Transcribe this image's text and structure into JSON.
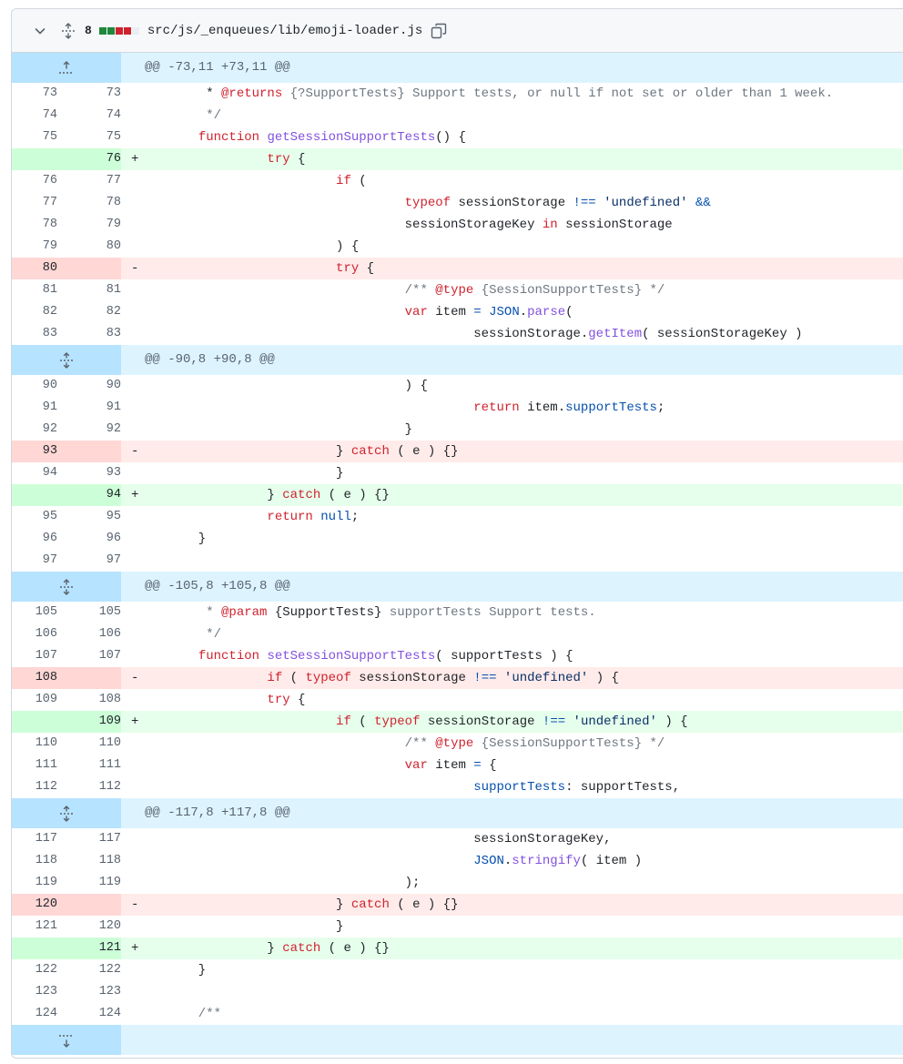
{
  "file": {
    "change_count": "8",
    "path": "src/js/_enqueues/lib/emoji-loader.js",
    "diffstat_colors": [
      "#1f883d",
      "#1f883d",
      "#cf222e",
      "#cf222e",
      "#eaeef2"
    ]
  },
  "hunks": [
    {
      "header": "@@ -73,11 +73,11 @@",
      "expand": "up",
      "lines": [
        {
          "type": "ctx",
          "old": "73",
          "new": "73",
          "tokens": [
            [
              "t",
              "        * "
            ],
            [
              "k",
              "@returns"
            ],
            [
              "c",
              " {?SupportTests} Support tests, or null if not set or older than 1 week."
            ]
          ]
        },
        {
          "type": "ctx",
          "old": "74",
          "new": "74",
          "tokens": [
            [
              "c",
              "        */"
            ]
          ]
        },
        {
          "type": "ctx",
          "old": "75",
          "new": "75",
          "tokens": [
            [
              "t",
              "       "
            ],
            [
              "k",
              "function"
            ],
            [
              "t",
              " "
            ],
            [
              "f",
              "getSessionSupportTests"
            ],
            [
              "t",
              "() {"
            ]
          ]
        },
        {
          "type": "add",
          "old": "",
          "new": "76",
          "sign": "+",
          "tokens": [
            [
              "t",
              "                "
            ],
            [
              "k",
              "try"
            ],
            [
              "t",
              " {"
            ]
          ]
        },
        {
          "type": "ctx",
          "old": "76",
          "new": "77",
          "tokens": [
            [
              "t",
              "                         "
            ],
            [
              "k",
              "if"
            ],
            [
              "t",
              " ("
            ]
          ]
        },
        {
          "type": "ctx",
          "old": "77",
          "new": "78",
          "tokens": [
            [
              "t",
              "                                  "
            ],
            [
              "k",
              "typeof"
            ],
            [
              "t",
              " sessionStorage "
            ],
            [
              "b",
              "!=="
            ],
            [
              "t",
              " "
            ],
            [
              "s",
              "'undefined'"
            ],
            [
              "t",
              " "
            ],
            [
              "b",
              "&&"
            ]
          ]
        },
        {
          "type": "ctx",
          "old": "78",
          "new": "79",
          "tokens": [
            [
              "t",
              "                                  sessionStorageKey "
            ],
            [
              "k",
              "in"
            ],
            [
              "t",
              " sessionStorage"
            ]
          ]
        },
        {
          "type": "ctx",
          "old": "79",
          "new": "80",
          "tokens": [
            [
              "t",
              "                         ) {"
            ]
          ]
        },
        {
          "type": "del",
          "old": "80",
          "new": "",
          "sign": "-",
          "tokens": [
            [
              "t",
              "                         "
            ],
            [
              "k",
              "try"
            ],
            [
              "t",
              " {"
            ]
          ]
        },
        {
          "type": "ctx",
          "old": "81",
          "new": "81",
          "tokens": [
            [
              "c",
              "                                  /** "
            ],
            [
              "k",
              "@type"
            ],
            [
              "c",
              " {SessionSupportTests} */"
            ]
          ]
        },
        {
          "type": "ctx",
          "old": "82",
          "new": "82",
          "tokens": [
            [
              "t",
              "                                  "
            ],
            [
              "k",
              "var"
            ],
            [
              "t",
              " item "
            ],
            [
              "b",
              "="
            ],
            [
              "t",
              " "
            ],
            [
              "b",
              "JSON"
            ],
            [
              "t",
              "."
            ],
            [
              "f",
              "parse"
            ],
            [
              "t",
              "("
            ]
          ]
        },
        {
          "type": "ctx",
          "old": "83",
          "new": "83",
          "tokens": [
            [
              "t",
              "                                           sessionStorage."
            ],
            [
              "f",
              "getItem"
            ],
            [
              "t",
              "( sessionStorageKey )"
            ]
          ]
        }
      ]
    },
    {
      "header": "@@ -90,8 +90,8 @@",
      "expand": "both",
      "lines": [
        {
          "type": "ctx",
          "old": "90",
          "new": "90",
          "tokens": [
            [
              "t",
              "                                  ) {"
            ]
          ]
        },
        {
          "type": "ctx",
          "old": "91",
          "new": "91",
          "tokens": [
            [
              "t",
              "                                           "
            ],
            [
              "k",
              "return"
            ],
            [
              "t",
              " item."
            ],
            [
              "b",
              "supportTests"
            ],
            [
              "t",
              ";"
            ]
          ]
        },
        {
          "type": "ctx",
          "old": "92",
          "new": "92",
          "tokens": [
            [
              "t",
              "                                  }"
            ]
          ]
        },
        {
          "type": "del",
          "old": "93",
          "new": "",
          "sign": "-",
          "tokens": [
            [
              "t",
              "                         } "
            ],
            [
              "k",
              "catch"
            ],
            [
              "t",
              " ( e ) {}"
            ]
          ]
        },
        {
          "type": "ctx",
          "old": "94",
          "new": "93",
          "tokens": [
            [
              "t",
              "                         }"
            ]
          ]
        },
        {
          "type": "add",
          "old": "",
          "new": "94",
          "sign": "+",
          "tokens": [
            [
              "t",
              "                } "
            ],
            [
              "k",
              "catch"
            ],
            [
              "t",
              " ( e ) {}"
            ]
          ]
        },
        {
          "type": "ctx",
          "old": "95",
          "new": "95",
          "tokens": [
            [
              "t",
              "                "
            ],
            [
              "k",
              "return"
            ],
            [
              "t",
              " "
            ],
            [
              "b",
              "null"
            ],
            [
              "t",
              ";"
            ]
          ]
        },
        {
          "type": "ctx",
          "old": "96",
          "new": "96",
          "tokens": [
            [
              "t",
              "       }"
            ]
          ]
        },
        {
          "type": "ctx",
          "old": "97",
          "new": "97",
          "tokens": []
        }
      ]
    },
    {
      "header": "@@ -105,8 +105,8 @@",
      "expand": "both",
      "lines": [
        {
          "type": "ctx",
          "old": "105",
          "new": "105",
          "tokens": [
            [
              "c",
              "        * "
            ],
            [
              "k",
              "@param"
            ],
            [
              "t",
              " {SupportTests}"
            ],
            [
              "c",
              " supportTests Support tests."
            ]
          ]
        },
        {
          "type": "ctx",
          "old": "106",
          "new": "106",
          "tokens": [
            [
              "c",
              "        */"
            ]
          ]
        },
        {
          "type": "ctx",
          "old": "107",
          "new": "107",
          "tokens": [
            [
              "t",
              "       "
            ],
            [
              "k",
              "function"
            ],
            [
              "t",
              " "
            ],
            [
              "f",
              "setSessionSupportTests"
            ],
            [
              "t",
              "( supportTests ) {"
            ]
          ]
        },
        {
          "type": "del",
          "old": "108",
          "new": "",
          "sign": "-",
          "tokens": [
            [
              "t",
              "                "
            ],
            [
              "k",
              "if"
            ],
            [
              "t",
              " ( "
            ],
            [
              "k",
              "typeof"
            ],
            [
              "t",
              " sessionStorage "
            ],
            [
              "b",
              "!=="
            ],
            [
              "t",
              " "
            ],
            [
              "s",
              "'undefined'"
            ],
            [
              "t",
              " ) {"
            ]
          ]
        },
        {
          "type": "ctx",
          "old": "109",
          "new": "108",
          "tokens": [
            [
              "t",
              "                "
            ],
            [
              "k",
              "try"
            ],
            [
              "t",
              " {"
            ]
          ]
        },
        {
          "type": "add",
          "old": "",
          "new": "109",
          "sign": "+",
          "tokens": [
            [
              "t",
              "                         "
            ],
            [
              "k",
              "if"
            ],
            [
              "t",
              " ( "
            ],
            [
              "k",
              "typeof"
            ],
            [
              "t",
              " sessionStorage "
            ],
            [
              "b",
              "!=="
            ],
            [
              "t",
              " "
            ],
            [
              "s",
              "'undefined'"
            ],
            [
              "t",
              " ) {"
            ]
          ]
        },
        {
          "type": "ctx",
          "old": "110",
          "new": "110",
          "tokens": [
            [
              "c",
              "                                  /** "
            ],
            [
              "k",
              "@type"
            ],
            [
              "c",
              " {SessionSupportTests} */"
            ]
          ]
        },
        {
          "type": "ctx",
          "old": "111",
          "new": "111",
          "tokens": [
            [
              "t",
              "                                  "
            ],
            [
              "k",
              "var"
            ],
            [
              "t",
              " item "
            ],
            [
              "b",
              "="
            ],
            [
              "t",
              " {"
            ]
          ]
        },
        {
          "type": "ctx",
          "old": "112",
          "new": "112",
          "tokens": [
            [
              "t",
              "                                           "
            ],
            [
              "b",
              "supportTests"
            ],
            [
              "t",
              ": supportTests,"
            ]
          ]
        }
      ]
    },
    {
      "header": "@@ -117,8 +117,8 @@",
      "expand": "both",
      "lines": [
        {
          "type": "ctx",
          "old": "117",
          "new": "117",
          "tokens": [
            [
              "t",
              "                                           sessionStorageKey,"
            ]
          ]
        },
        {
          "type": "ctx",
          "old": "118",
          "new": "118",
          "tokens": [
            [
              "t",
              "                                           "
            ],
            [
              "b",
              "JSON"
            ],
            [
              "t",
              "."
            ],
            [
              "f",
              "stringify"
            ],
            [
              "t",
              "( item )"
            ]
          ]
        },
        {
          "type": "ctx",
          "old": "119",
          "new": "119",
          "tokens": [
            [
              "t",
              "                                  );"
            ]
          ]
        },
        {
          "type": "del",
          "old": "120",
          "new": "",
          "sign": "-",
          "tokens": [
            [
              "t",
              "                         } "
            ],
            [
              "k",
              "catch"
            ],
            [
              "t",
              " ( e ) {}"
            ]
          ]
        },
        {
          "type": "ctx",
          "old": "121",
          "new": "120",
          "tokens": [
            [
              "t",
              "                         }"
            ]
          ]
        },
        {
          "type": "add",
          "old": "",
          "new": "121",
          "sign": "+",
          "tokens": [
            [
              "t",
              "                } "
            ],
            [
              "k",
              "catch"
            ],
            [
              "t",
              " ( e ) {}"
            ]
          ]
        },
        {
          "type": "ctx",
          "old": "122",
          "new": "122",
          "tokens": [
            [
              "t",
              "       }"
            ]
          ]
        },
        {
          "type": "ctx",
          "old": "123",
          "new": "123",
          "tokens": []
        },
        {
          "type": "ctx",
          "old": "124",
          "new": "124",
          "tokens": [
            [
              "c",
              "       /**"
            ]
          ]
        }
      ]
    },
    {
      "header": "",
      "expand": "down",
      "lines": []
    }
  ]
}
